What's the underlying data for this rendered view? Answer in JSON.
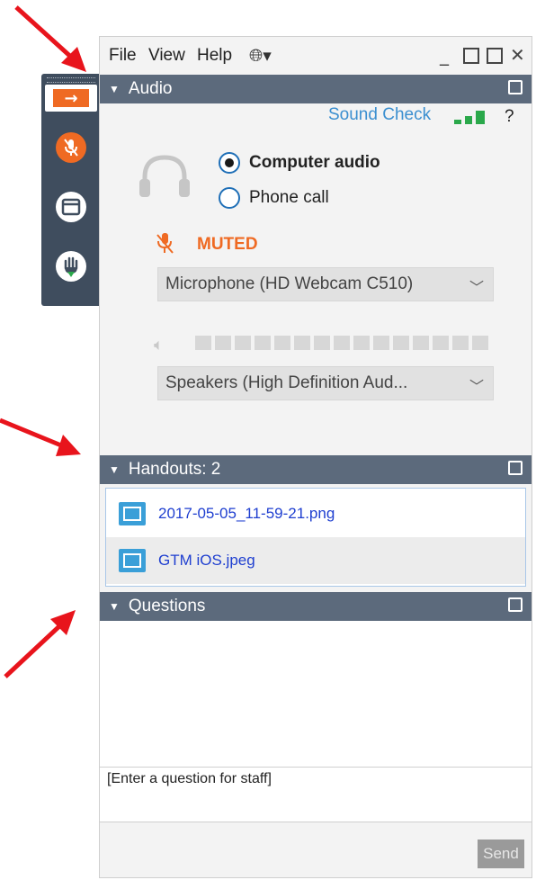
{
  "menu": {
    "file": "File",
    "view": "View",
    "help": "Help"
  },
  "audio": {
    "header": "Audio",
    "sound_check": "Sound Check",
    "help_mark": "?",
    "computer_audio": "Computer audio",
    "phone_call": "Phone call",
    "muted": "MUTED",
    "microphone": "Microphone (HD Webcam C510)",
    "speakers": "Speakers (High Definition Aud...",
    "selected_mode": "Computer audio"
  },
  "handouts": {
    "header": "Handouts: 2",
    "files": [
      "2017-05-05_11-59-21.png",
      "GTM iOS.jpeg"
    ]
  },
  "questions": {
    "header": "Questions",
    "input_placeholder": "[Enter a question for staff]",
    "send": "Send"
  },
  "colors": {
    "accent_orange": "#ef6a23",
    "header_bg": "#5c6a7c",
    "sidebar_bg": "#3f4d5e",
    "link_blue": "#3b8fd0",
    "arrow_red": "#e8141c",
    "signal_green": "#2aa84a"
  }
}
